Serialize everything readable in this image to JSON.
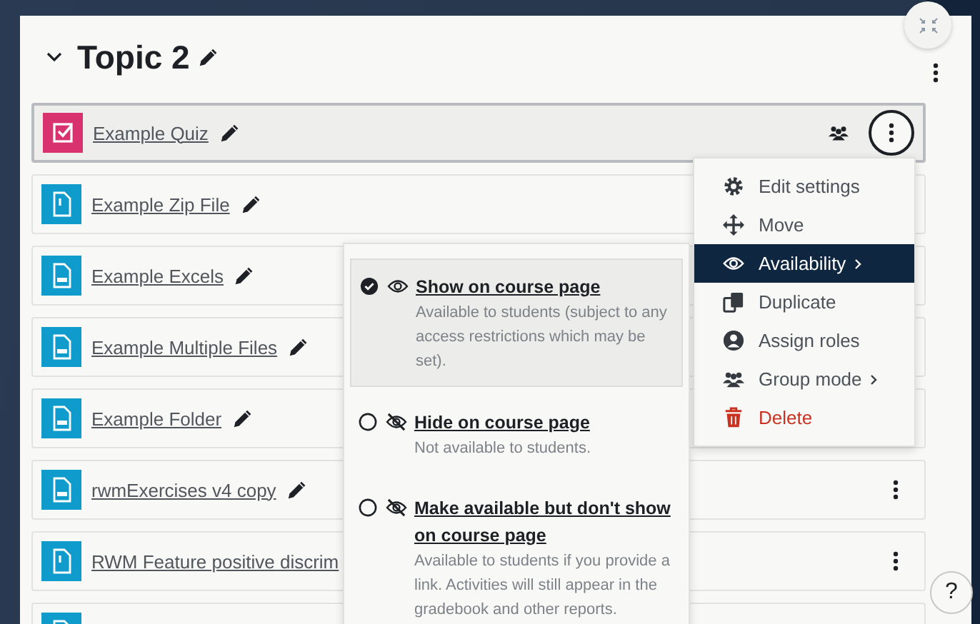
{
  "section": {
    "title": "Topic 2",
    "expanded": true
  },
  "activities": [
    {
      "kind": "quiz",
      "title": "Example Quiz",
      "selected": true,
      "group_mode": true,
      "menu_button": true
    },
    {
      "kind": "file",
      "title": "Example Zip File",
      "selected": false
    },
    {
      "kind": "spreadsheet",
      "title": "Example Excels",
      "selected": false
    },
    {
      "kind": "spreadsheet",
      "title": "Example Multiple Files",
      "selected": false
    },
    {
      "kind": "spreadsheet",
      "title": "Example Folder",
      "selected": false
    },
    {
      "kind": "spreadsheet",
      "title": "rwmExercises v4 copy",
      "selected": false,
      "group_mode": false,
      "menu_button": true
    },
    {
      "kind": "file",
      "title": "RWM Feature positive discrim",
      "selected": false,
      "group_mode": false,
      "menu_button": true
    },
    {
      "kind": "file",
      "selected": false
    }
  ],
  "action_menu": [
    {
      "label": "Edit settings",
      "kind": "item",
      "selected": false
    },
    {
      "label": "Move",
      "kind": "item",
      "selected": false
    },
    {
      "label": "Availability",
      "kind": "submenu",
      "selected": true
    },
    {
      "label": "Duplicate",
      "kind": "item",
      "selected": false
    },
    {
      "label": "Assign roles",
      "kind": "item",
      "selected": false
    },
    {
      "label": "Group mode",
      "kind": "submenu",
      "selected": false
    },
    {
      "label": "Delete",
      "kind": "danger",
      "selected": false
    }
  ],
  "availability_menu": [
    {
      "title": "Show on course page",
      "description": "Available to students (subject to any access restrictions which may be set).",
      "selected": true
    },
    {
      "title": "Hide on course page",
      "description": "Not available to students.",
      "selected": false
    },
    {
      "title": "Make available but don't show on course page",
      "description": "Available to students if you provide a link. Activities will still appear in the gradebook and other reports.",
      "selected": false
    }
  ],
  "help_button": "?"
}
